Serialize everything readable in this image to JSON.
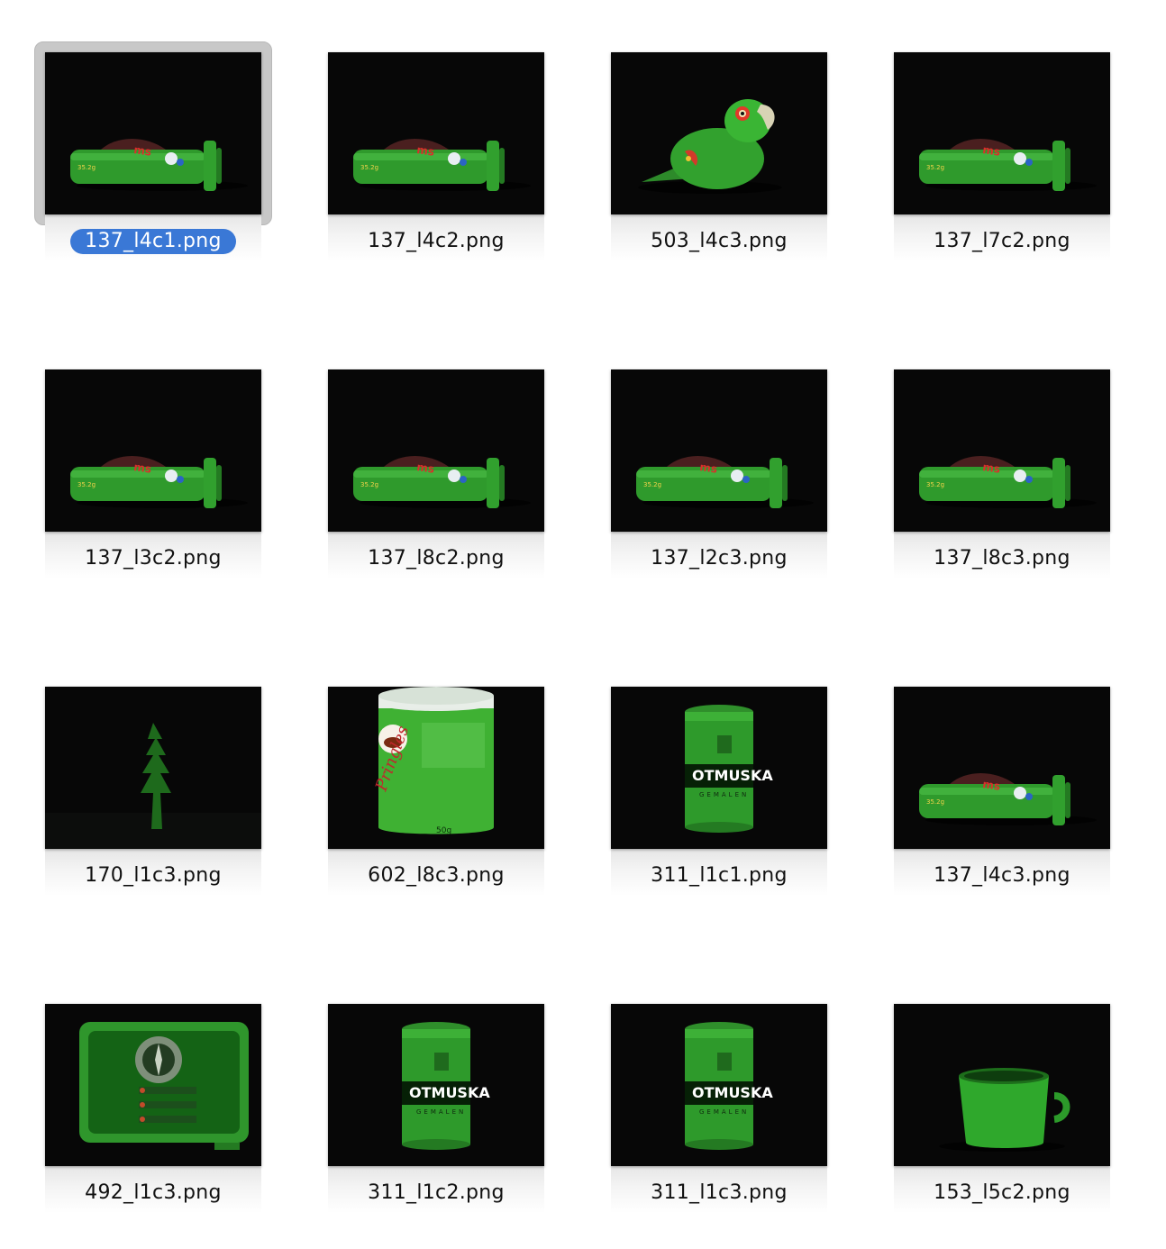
{
  "selection_color": "#3a78d6",
  "files": [
    {
      "name": "137_l4c1.png",
      "subject": "tube",
      "selected": true
    },
    {
      "name": "137_l4c2.png",
      "subject": "tube"
    },
    {
      "name": "503_l4c3.png",
      "subject": "parrot"
    },
    {
      "name": "137_l7c2.png",
      "subject": "tube"
    },
    {
      "name": "137_l3c2.png",
      "subject": "tube"
    },
    {
      "name": "137_l8c2.png",
      "subject": "tube"
    },
    {
      "name": "137_l2c3.png",
      "subject": "tube"
    },
    {
      "name": "137_l8c3.png",
      "subject": "tube"
    },
    {
      "name": "170_l1c3.png",
      "subject": "tree"
    },
    {
      "name": "602_l8c3.png",
      "subject": "can-pringles"
    },
    {
      "name": "311_l1c1.png",
      "subject": "tin"
    },
    {
      "name": "137_l4c3.png",
      "subject": "tube"
    },
    {
      "name": "492_l1c3.png",
      "subject": "radio"
    },
    {
      "name": "311_l1c2.png",
      "subject": "tin"
    },
    {
      "name": "311_l1c3.png",
      "subject": "tin"
    },
    {
      "name": "153_l5c2.png",
      "subject": "mug"
    }
  ]
}
